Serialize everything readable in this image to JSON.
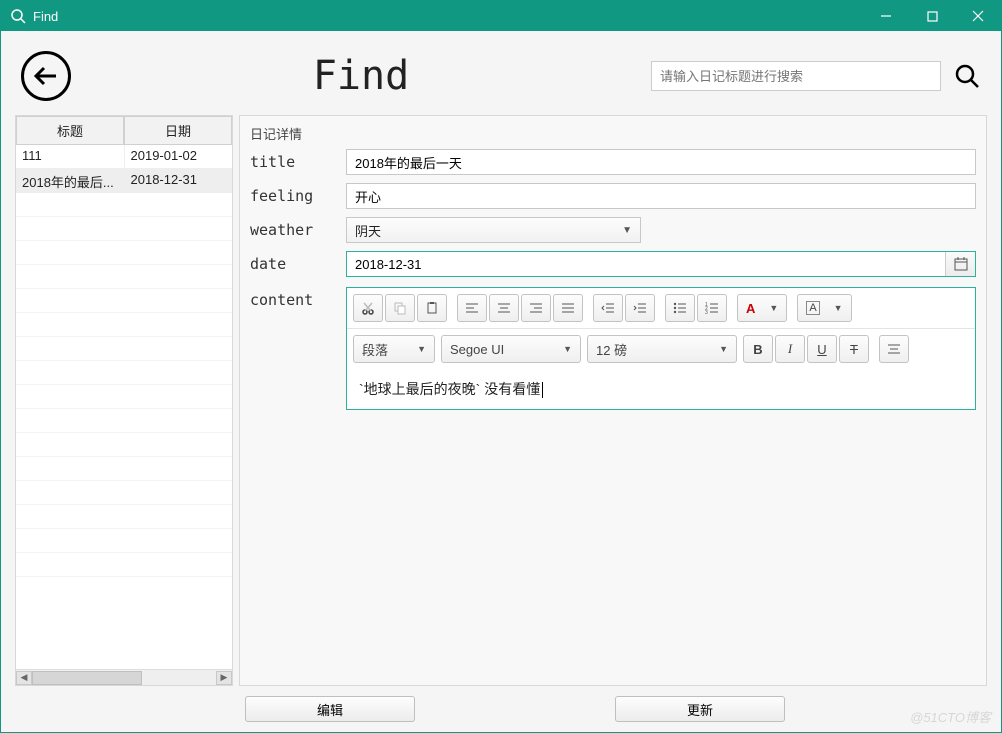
{
  "window": {
    "title": "Find"
  },
  "header": {
    "page_title": "Find",
    "search_placeholder": "请输入日记标题进行搜索"
  },
  "sidebar": {
    "columns": [
      "标题",
      "日期"
    ],
    "rows": [
      {
        "title": "111",
        "date": "2019-01-02",
        "selected": false
      },
      {
        "title": "2018年的最后...",
        "date": "2018-12-31",
        "selected": true
      }
    ]
  },
  "detail": {
    "group_title": "日记详情",
    "labels": {
      "title": "title",
      "feeling": "feeling",
      "weather": "weather",
      "date": "date",
      "content": "content"
    },
    "values": {
      "title": "2018年的最后一天",
      "feeling": "开心",
      "weather": "阴天",
      "date": "2018-12-31",
      "content": "`地球上最后的夜晚` 没有看懂"
    }
  },
  "editor_toolbar": {
    "para_style": "段落",
    "font_family": "Segoe UI",
    "font_size": "12 磅",
    "font_color_label": "A"
  },
  "buttons": {
    "edit": "编辑",
    "update": "更新"
  },
  "watermark": "@51CTO博客"
}
